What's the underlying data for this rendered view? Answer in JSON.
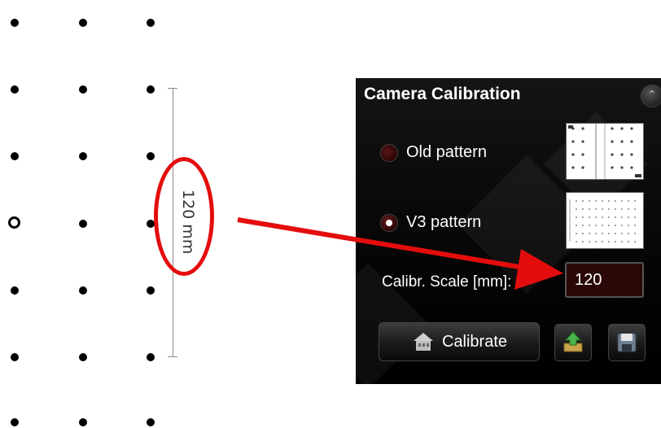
{
  "scale_annotation": {
    "label": "120 mm"
  },
  "panel": {
    "title": "Camera Calibration",
    "old_pattern_label": "Old pattern",
    "v3_pattern_label": "V3 pattern",
    "selected_pattern": "V3 pattern",
    "scale_label": "Calibr. Scale [mm]:",
    "scale_value": "120",
    "calibrate_label": "Calibrate"
  },
  "icons": {
    "collapse": "chevron-up-icon",
    "calibrate": "building-icon",
    "load": "upload-icon",
    "save": "floppy-disk-icon"
  },
  "colors": {
    "highlight": "#e40d0d",
    "panel_bg": "#050505",
    "input_bg": "#2a0808"
  }
}
